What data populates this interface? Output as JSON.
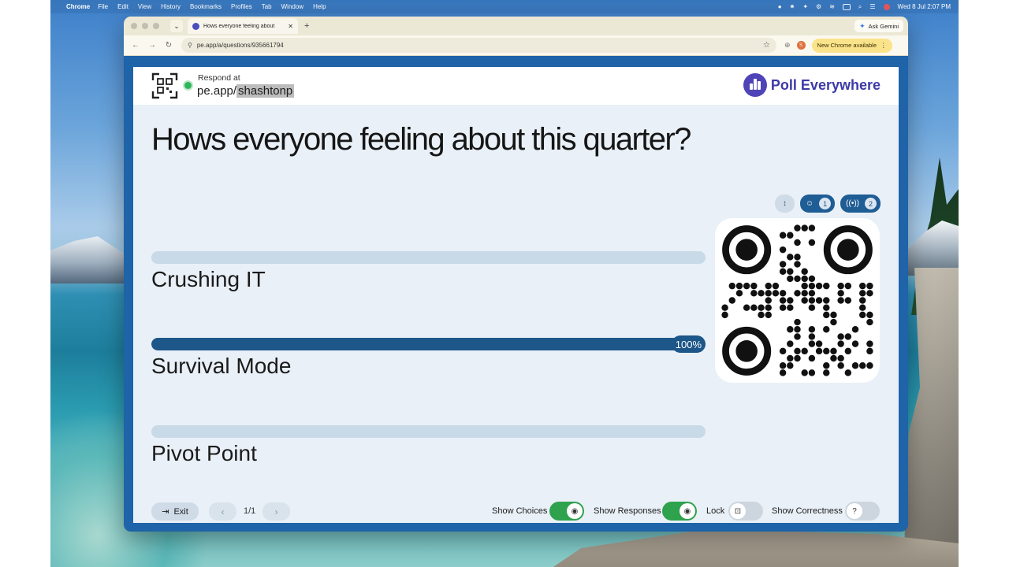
{
  "menubar": {
    "app": "Chrome",
    "items": [
      "File",
      "Edit",
      "View",
      "History",
      "Bookmarks",
      "Profiles",
      "Tab",
      "Window",
      "Help"
    ],
    "datetime": "Wed 8 Jul  2:07 PM"
  },
  "browser": {
    "tab_title": "Hows everyone feeling about",
    "ask_gemini": "Ask Gemini",
    "url": "pe.app/a/questions/935661794",
    "profile_initial": "S",
    "update_label": "New Chrome available"
  },
  "header": {
    "respond_at": "Respond at",
    "url_prefix": "pe.app/",
    "url_handle": "shashtonp",
    "brand": "Poll Everywhere"
  },
  "question": "Hows everyone feeling about this quarter?",
  "counters": {
    "participants": "1",
    "responses": "2"
  },
  "choices": [
    {
      "label": "Crushing IT",
      "percent": 0,
      "pct_label": ""
    },
    {
      "label": "Survival Mode",
      "percent": 100,
      "pct_label": "100%"
    },
    {
      "label": "Pivot Point",
      "percent": 0,
      "pct_label": ""
    }
  ],
  "footer": {
    "exit": "Exit",
    "page": "1/1",
    "show_choices": {
      "label": "Show Choices",
      "on": true
    },
    "show_responses": {
      "label": "Show Responses",
      "on": true
    },
    "lock": {
      "label": "Lock",
      "on": false
    },
    "show_correctness": {
      "label": "Show Correctness",
      "on": false
    }
  },
  "colors": {
    "accent": "#1d5688",
    "toggle_on": "#2ea24d",
    "brand": "#3d3aa8"
  }
}
